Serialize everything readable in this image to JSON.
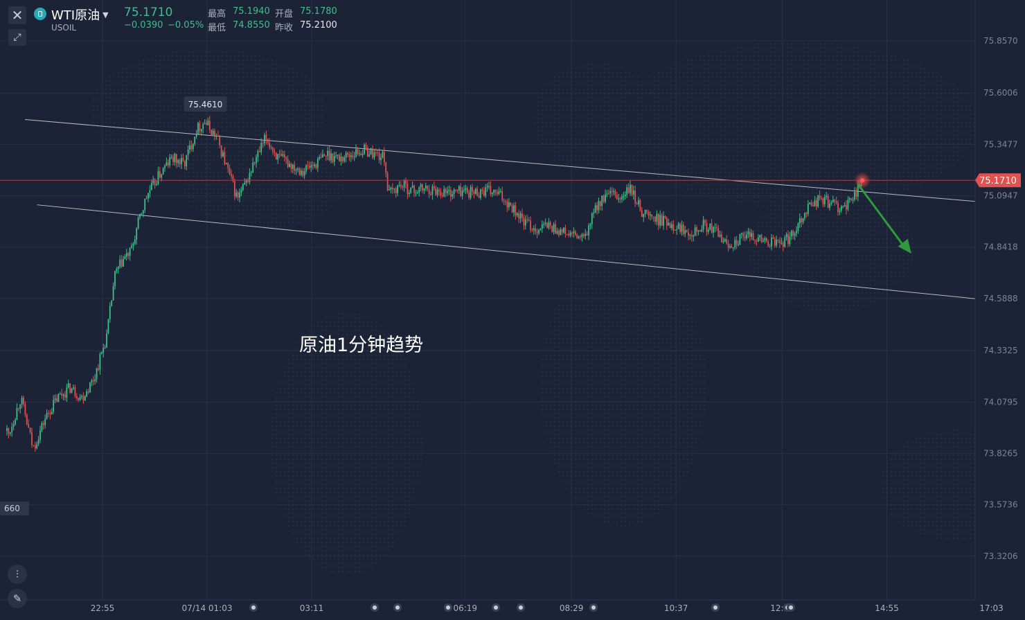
{
  "header": {
    "symbol_name": "WTI原油",
    "symbol_code": "USOIL",
    "last_price": "75.1710",
    "change": "−0.0390",
    "change_pct": "−0.05%",
    "high_label": "最高",
    "high_value": "75.1940",
    "open_label": "开盘",
    "open_value": "75.1780",
    "low_label": "最低",
    "low_value": "74.8550",
    "prev_close_label": "昨收",
    "prev_close_value": "75.2100"
  },
  "annotation_text": "原油1分钟趋势",
  "colors": {
    "background": "#1c2336",
    "up": "#3fbf8a",
    "down": "#e0524f",
    "trend_arrow": "#2e9a3c",
    "price_tag": "#e0524f",
    "channel_line": "#b8bcc6"
  },
  "icons": [
    "close-icon",
    "expand-icon",
    "symbol-logo-icon",
    "chevron-down-icon",
    "candles-icon",
    "pencil-icon"
  ],
  "chart_data": {
    "type": "candlestick",
    "y_ticks": [
      "75.8570",
      "75.6006",
      "75.3477",
      "75.0947",
      "74.8418",
      "74.5888",
      "74.3325",
      "74.0795",
      "73.8265",
      "73.5736",
      "73.3206"
    ],
    "ylim": [
      73.25,
      75.95
    ],
    "x_ticks": [
      "22:55",
      "07/14 01:03",
      "03:11",
      "06:19",
      "08:29",
      "10:37",
      "12:47",
      "14:55",
      "17:03"
    ],
    "crosshair_price": "75.1710",
    "peak_label": "75.4610",
    "left_partial_label": "660",
    "channel_upper": [
      [
        "21:20",
        75.47
      ],
      [
        "17:03",
        75.06
      ]
    ],
    "channel_lower": [
      [
        "21:35",
        75.05
      ],
      [
        "17:03",
        74.58
      ]
    ],
    "trend_arrow": {
      "from": [
        "14:20",
        75.15
      ],
      "to": [
        "15:25",
        74.81
      ],
      "direction": "down"
    },
    "price_path": [
      [
        "20:00",
        73.85
      ],
      [
        "20:15",
        74.2
      ],
      [
        "20:30",
        74.45
      ],
      [
        "20:45",
        74.05
      ],
      [
        "21:00",
        73.92
      ],
      [
        "21:15",
        74.1
      ],
      [
        "21:30",
        73.85
      ],
      [
        "21:45",
        74.0
      ],
      [
        "22:00",
        74.1
      ],
      [
        "22:15",
        74.15
      ],
      [
        "22:30",
        74.1
      ],
      [
        "22:45",
        74.2
      ],
      [
        "23:00",
        74.4
      ],
      [
        "23:10",
        74.7
      ],
      [
        "23:20",
        74.78
      ],
      [
        "23:30",
        74.82
      ],
      [
        "23:40",
        74.98
      ],
      [
        "23:50",
        75.1
      ],
      [
        "00:05",
        75.2
      ],
      [
        "00:20",
        75.28
      ],
      [
        "00:35",
        75.25
      ],
      [
        "00:50",
        75.42
      ],
      [
        "01:00",
        75.46
      ],
      [
        "01:15",
        75.38
      ],
      [
        "01:30",
        75.2
      ],
      [
        "01:40",
        75.08
      ],
      [
        "01:50",
        75.15
      ],
      [
        "02:00",
        75.25
      ],
      [
        "02:15",
        75.38
      ],
      [
        "02:30",
        75.28
      ],
      [
        "02:45",
        75.25
      ],
      [
        "03:00",
        75.22
      ],
      [
        "03:15",
        75.25
      ],
      [
        "03:30",
        75.3
      ],
      [
        "03:45",
        75.28
      ],
      [
        "04:00",
        75.3
      ],
      [
        "04:15",
        75.32
      ],
      [
        "04:30",
        75.3
      ],
      [
        "04:40",
        75.28
      ],
      [
        "04:45",
        75.1
      ],
      [
        "05:00",
        75.15
      ],
      [
        "05:15",
        75.12
      ],
      [
        "05:30",
        75.13
      ],
      [
        "05:45",
        75.12
      ],
      [
        "06:00",
        75.11
      ],
      [
        "06:15",
        75.12
      ],
      [
        "06:30",
        75.11
      ],
      [
        "06:45",
        75.12
      ],
      [
        "07:00",
        75.1
      ],
      [
        "07:15",
        75.05
      ],
      [
        "07:30",
        74.97
      ],
      [
        "07:45",
        74.93
      ],
      [
        "08:00",
        74.95
      ],
      [
        "08:15",
        74.92
      ],
      [
        "08:30",
        74.9
      ],
      [
        "08:45",
        74.88
      ],
      [
        "09:00",
        75.05
      ],
      [
        "09:15",
        75.1
      ],
      [
        "09:30",
        75.08
      ],
      [
        "09:40",
        75.13
      ],
      [
        "09:55",
        75.02
      ],
      [
        "10:10",
        74.98
      ],
      [
        "10:25",
        74.97
      ],
      [
        "10:40",
        74.94
      ],
      [
        "10:55",
        74.92
      ],
      [
        "11:10",
        74.95
      ],
      [
        "11:25",
        74.92
      ],
      [
        "11:40",
        74.85
      ],
      [
        "11:55",
        74.88
      ],
      [
        "12:10",
        74.9
      ],
      [
        "12:25",
        74.87
      ],
      [
        "12:40",
        74.86
      ],
      [
        "12:55",
        74.88
      ],
      [
        "13:05",
        74.95
      ],
      [
        "13:20",
        75.05
      ],
      [
        "13:35",
        75.08
      ],
      [
        "13:50",
        75.05
      ],
      [
        "14:05",
        75.03
      ],
      [
        "14:15",
        75.1
      ],
      [
        "14:25",
        75.17
      ]
    ]
  }
}
